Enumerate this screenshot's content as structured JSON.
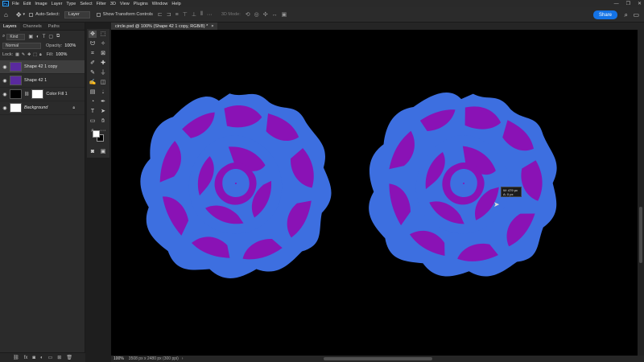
{
  "menubar": {
    "logo": "Ps",
    "items": [
      "File",
      "Edit",
      "Image",
      "Layer",
      "Type",
      "Select",
      "Filter",
      "3D",
      "View",
      "Plugins",
      "Window",
      "Help"
    ],
    "window_controls": [
      "—",
      "❐",
      "✕"
    ]
  },
  "options": {
    "auto_select_label": "Auto-Select:",
    "auto_select_value": "Layer",
    "transform_label": "Show Transform Controls",
    "mode_3d_label": "3D Mode:",
    "share_label": "Share"
  },
  "layers_panel": {
    "tabs": [
      "Layers",
      "Channels",
      "Paths"
    ],
    "filter_kind": "Kind",
    "blend_mode": "Normal",
    "opacity_label": "Opacity:",
    "opacity_value": "100%",
    "lock_label": "Lock:",
    "fill_label": "Fill:",
    "fill_value": "100%",
    "layers": [
      {
        "name": "Shape 42 1 copy",
        "selected": true
      },
      {
        "name": "Shape 42 1",
        "selected": false
      },
      {
        "name": "Color Fill 1",
        "selected": false
      },
      {
        "name": "Background",
        "selected": false
      }
    ]
  },
  "document": {
    "tab_title": "circle.psd @ 100% (Shape 42 1 copy, RGB/8) *",
    "close_glyph": "×"
  },
  "statusbar": {
    "zoom": "100%",
    "doc_info": "3508 px x 2480 px (300 ppi)"
  },
  "tooltip": {
    "line1": "W: 479 px",
    "line2": "A: 0 px"
  },
  "colors": {
    "flower_blue": "#3d6fe0",
    "flower_purple": "#8a12b5",
    "canvas_bg": "#000000",
    "accent": "#1473e6"
  }
}
